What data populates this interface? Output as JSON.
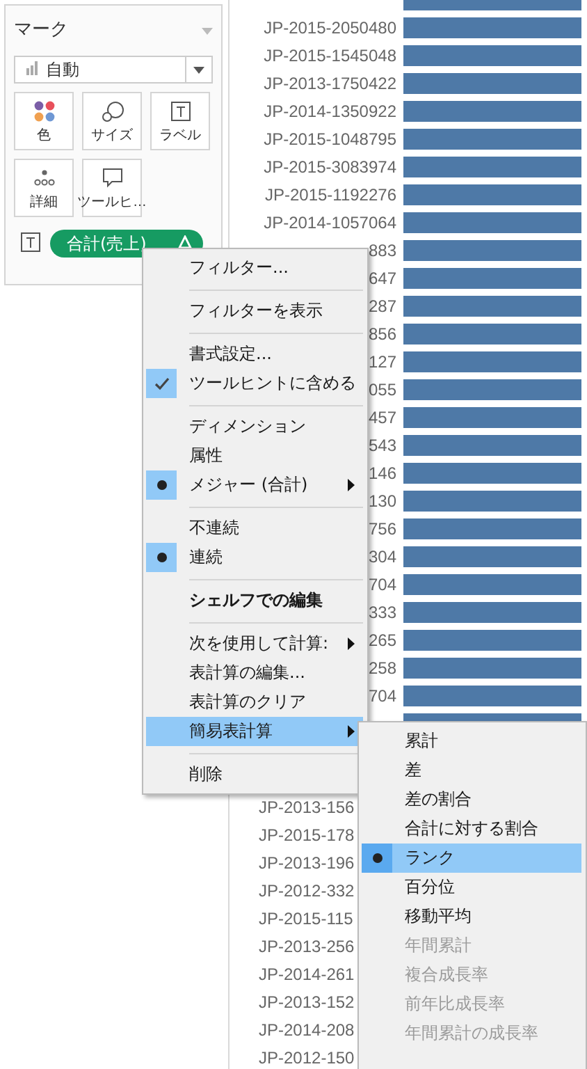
{
  "marks_panel": {
    "title": "マーク",
    "mark_type": "自動",
    "cards": [
      {
        "kind": "color",
        "label": "色"
      },
      {
        "kind": "size",
        "label": "サイズ"
      },
      {
        "kind": "label",
        "label": "ラベル"
      },
      {
        "kind": "detail",
        "label": "詳細"
      },
      {
        "kind": "tooltip",
        "label": "ツールヒ…"
      }
    ],
    "pill": {
      "label": "合計(売上)",
      "table_calc": true
    }
  },
  "table_rows": [
    {},
    {
      "label": "JP-2015-2050480"
    },
    {
      "label": "JP-2015-1545048"
    },
    {
      "label": "JP-2013-1750422"
    },
    {
      "label": "JP-2014-1350922"
    },
    {
      "label": "JP-2015-1048795"
    },
    {
      "label": "JP-2015-3083974"
    },
    {
      "label": "JP-2015-1192276"
    },
    {
      "label": "JP-2014-1057064"
    },
    {
      "label": "883",
      "cut_start": true
    },
    {
      "label": "647",
      "cut_start": true
    },
    {
      "label": "287",
      "cut_start": true
    },
    {
      "label": "856",
      "cut_start": true
    },
    {
      "label": "127",
      "cut_start": true
    },
    {
      "label": "055",
      "cut_start": true
    },
    {
      "label": "457",
      "cut_start": true
    },
    {
      "label": "543",
      "cut_start": true
    },
    {
      "label": "146",
      "cut_start": true
    },
    {
      "label": "130",
      "cut_start": true
    },
    {
      "label": "756",
      "cut_start": true
    },
    {
      "label": "304",
      "cut_start": true
    },
    {
      "label": "704",
      "cut_start": true
    },
    {
      "label": "333",
      "cut_start": true
    },
    {
      "label": "265",
      "cut_start": true
    },
    {
      "label": "258",
      "cut_start": true
    },
    {
      "label": "704",
      "cut_start": true
    },
    {},
    {},
    {},
    {
      "label": "JP-2013-156",
      "cut_end": true
    },
    {
      "label": "JP-2015-178",
      "cut_end": true
    },
    {
      "label": "JP-2013-196",
      "cut_end": true
    },
    {
      "label": "JP-2012-332",
      "cut_end": true
    },
    {
      "label": "JP-2015-115",
      "cut_end": true
    },
    {
      "label": "JP-2013-256",
      "cut_end": true
    },
    {
      "label": "JP-2014-261",
      "cut_end": true
    },
    {
      "label": "JP-2013-152",
      "cut_end": true
    },
    {
      "label": "JP-2014-208",
      "cut_end": true
    },
    {
      "label": "JP-2012-150",
      "cut_end": true
    }
  ],
  "context_menu": {
    "items": [
      {
        "kind": "item",
        "label": "フィルター...",
        "selected": false
      },
      {
        "kind": "separator"
      },
      {
        "kind": "item",
        "label": "フィルターを表示",
        "selected": false
      },
      {
        "kind": "separator"
      },
      {
        "kind": "item",
        "label": "書式設定...",
        "selected": false
      },
      {
        "kind": "check",
        "label": "ツールヒントに含める",
        "checked": true,
        "selected": false
      },
      {
        "kind": "separator"
      },
      {
        "kind": "item",
        "label": "ディメンション",
        "selected": false
      },
      {
        "kind": "item",
        "label": "属性",
        "selected": false
      },
      {
        "kind": "radio",
        "label": "メジャー (合計)",
        "checked": true,
        "submenu": true,
        "selected": false
      },
      {
        "kind": "separator"
      },
      {
        "kind": "item",
        "label": "不連続",
        "selected": false
      },
      {
        "kind": "radio",
        "label": "連続",
        "checked": true,
        "selected": false
      },
      {
        "kind": "separator"
      },
      {
        "kind": "item",
        "label": "シェルフでの編集",
        "bold": true,
        "selected": false
      },
      {
        "kind": "separator"
      },
      {
        "kind": "item",
        "label": "次を使用して計算:",
        "submenu": true,
        "selected": false
      },
      {
        "kind": "calc",
        "label": "表計算の編集...",
        "selected": false
      },
      {
        "kind": "item",
        "label": "表計算のクリア",
        "selected": false
      },
      {
        "kind": "item",
        "label": "簡易表計算",
        "submenu": true,
        "selected": true
      },
      {
        "kind": "separator"
      },
      {
        "kind": "item",
        "label": "削除",
        "selected": false
      }
    ]
  },
  "submenu": {
    "items": [
      {
        "kind": "item",
        "label": "累計",
        "selected": false
      },
      {
        "kind": "item",
        "label": "差",
        "selected": false
      },
      {
        "kind": "item",
        "label": "差の割合",
        "selected": false
      },
      {
        "kind": "item",
        "label": "合計に対する割合",
        "selected": false
      },
      {
        "kind": "radio",
        "label": "ランク",
        "checked": true,
        "selected": true
      },
      {
        "kind": "item",
        "label": "百分位",
        "selected": false
      },
      {
        "kind": "item",
        "label": "移動平均",
        "selected": false
      },
      {
        "kind": "item",
        "label": "年間累計",
        "disabled": true,
        "selected": false
      },
      {
        "kind": "item",
        "label": "複合成長率",
        "disabled": true,
        "selected": false
      },
      {
        "kind": "item",
        "label": "前年比成長率",
        "disabled": true,
        "selected": false
      },
      {
        "kind": "item",
        "label": "年間累計の成長率",
        "disabled": true,
        "selected": false
      }
    ]
  }
}
